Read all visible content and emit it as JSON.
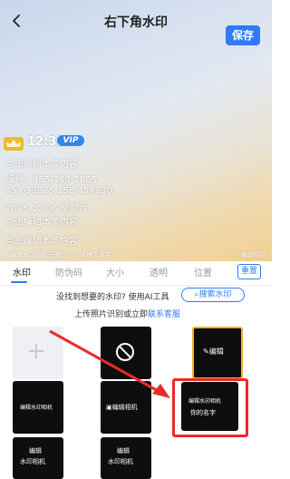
{
  "header": {
    "title": "右下角水印",
    "save_label": "保存"
  },
  "watermark": {
    "time": "12:32",
    "vip": "VIP",
    "lines": [
      "点击编辑本条内容",
      "编号：455-149-1805",
      "45.633825,158.454230",
      "2025.12.06 星期六",
      "点击编辑本条内容",
      "点击编辑本条内容"
    ],
    "verified_text": "编辑水印相机已验证 | 时间地点真实",
    "corner_label": "编辑相机"
  },
  "tabs": [
    {
      "label": "水印",
      "active": true
    },
    {
      "label": "防伪码",
      "active": false
    },
    {
      "label": "大小",
      "active": false
    },
    {
      "label": "透明",
      "active": false
    },
    {
      "label": "位置",
      "active": false
    }
  ],
  "reset_label": "重置",
  "prompt": {
    "line1": "没找到想要的水印? 使用AI工具",
    "search_button": "搜索水印",
    "line2_prefix": "上传照片识别或立即",
    "line2_link": "联系客服"
  },
  "grid": {
    "edit_label": "编辑",
    "r2a_text": "编辑水印相机",
    "r2b_text": "编辑相机",
    "r2c_line1": "编辑水印相机",
    "r2c_line2": "你的名字",
    "r3a_line1": "编辑",
    "r3a_line2": "水印相机",
    "r3b_line1": "编辑",
    "r3b_line2": "水印相机"
  },
  "colors": {
    "accent": "#2f7bf6",
    "highlight": "#ea2a2a",
    "selected_border": "#f5b321",
    "vip": "#2e87ea"
  }
}
